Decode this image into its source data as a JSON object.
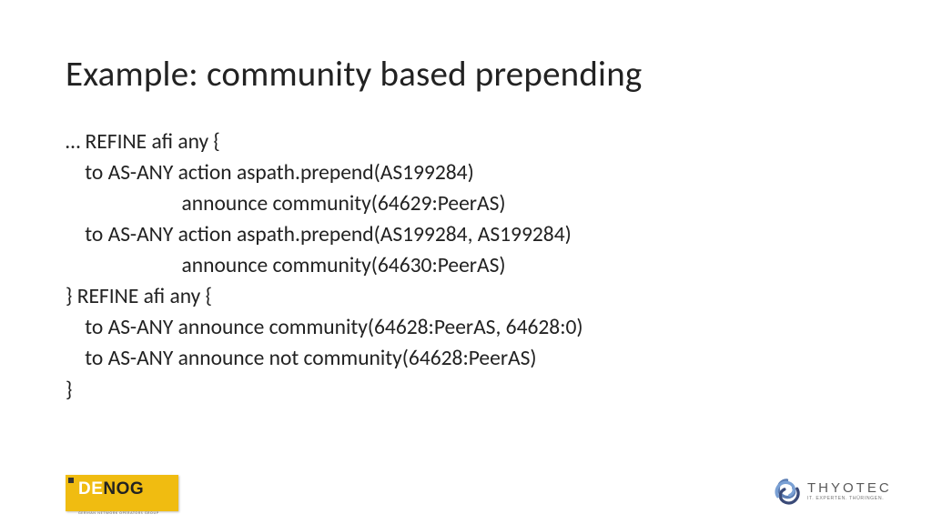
{
  "title": "Example: community based prepending",
  "code": "… REFINE afi any {\n    to AS-ANY action aspath.prepend(AS199284)\n                        announce community(64629:PeerAS)\n    to AS-ANY action aspath.prepend(AS199284, AS199284)\n                        announce community(64630:PeerAS)\n} REFINE afi any {\n    to AS-ANY announce community(64628:PeerAS, 64628:0)\n    to AS-ANY announce not community(64628:PeerAS)\n}",
  "logos": {
    "left": {
      "de": "DE",
      "nog": "NOG",
      "sub": "GERMAN NETWORK OPERATORS GROUP"
    },
    "right": {
      "name": "THYOTEC",
      "tag": "IT. EXPERTEN. THÜRINGEN."
    }
  }
}
